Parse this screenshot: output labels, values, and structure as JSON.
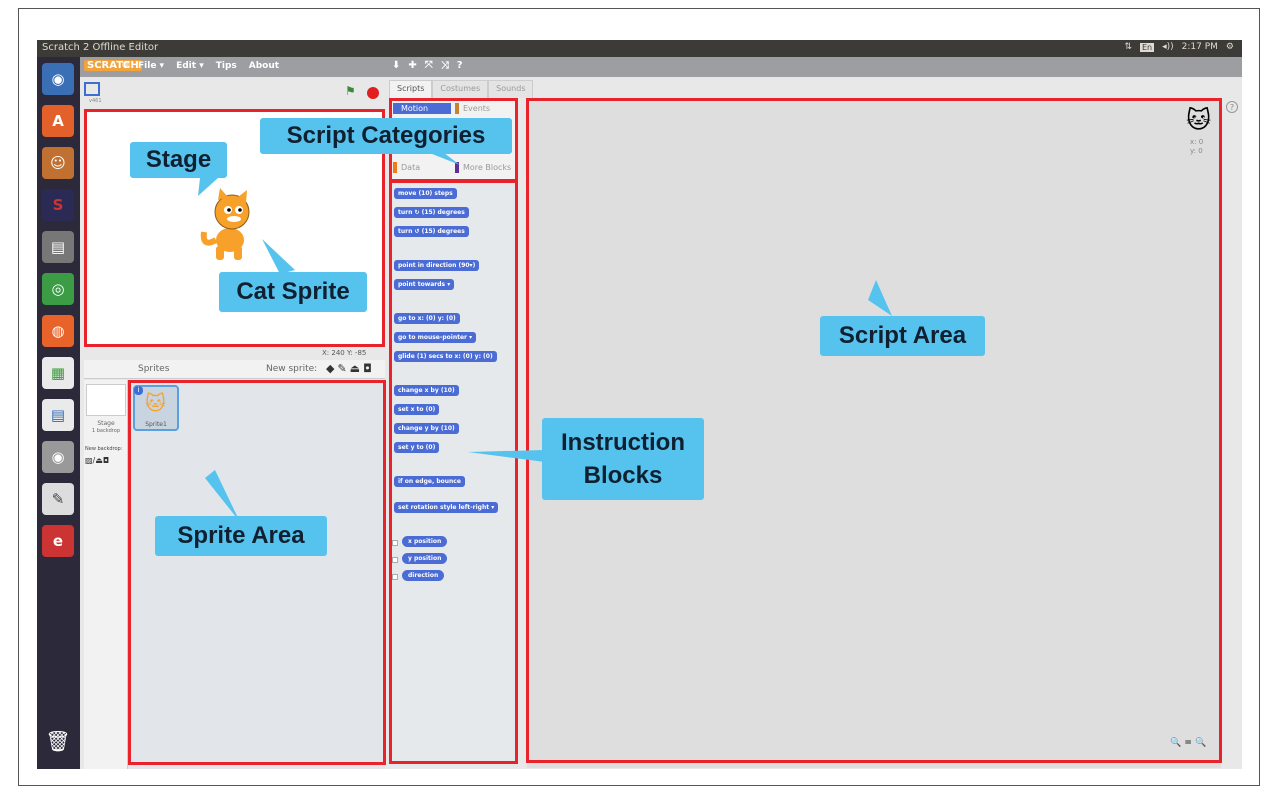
{
  "window": {
    "title": "Scratch 2 Offline Editor"
  },
  "tray": {
    "kbd": "En",
    "volume": "◂))",
    "time": "2:17 PM"
  },
  "menu": {
    "logo": "SCRATCH",
    "items": [
      "File ▾",
      "Edit ▾",
      "Tips",
      "About"
    ]
  },
  "stage": {
    "version": "v461",
    "coords_x": "X: 240",
    "coords_y": "Y: -85"
  },
  "tabs": [
    "Scripts",
    "Costumes",
    "Sounds"
  ],
  "categories": {
    "motion": "Motion",
    "events": "Events",
    "data": "Data",
    "more": "More Blocks"
  },
  "blocks": [
    "move (10) steps",
    "turn ↻ (15) degrees",
    "turn ↺ (15) degrees",
    "point in direction (90▾)",
    "point towards ▾",
    "go to x: (0) y: (0)",
    "go to mouse-pointer ▾",
    "glide (1) secs to x: (0) y: (0)",
    "change x by (10)",
    "set x to (0)",
    "change y by (10)",
    "set y to (0)",
    "if on edge, bounce",
    "set rotation style left-right ▾"
  ],
  "reporters": [
    "x position",
    "y position",
    "direction"
  ],
  "sprites_panel": {
    "header": "Sprites",
    "new_sprite": "New sprite:",
    "stage_label": "Stage",
    "stage_sub": "1 backdrop",
    "new_backdrop": "New backdrop:",
    "sprite_name": "Sprite1",
    "sprite_index": "i"
  },
  "script_xy": {
    "x": "x: 0",
    "y": "y: 0"
  },
  "zoom": "🔍 = 🔍",
  "annotations": {
    "script_categories": "Script Categories",
    "stage": "Stage",
    "cat_sprite": "Cat Sprite",
    "script_area": "Script Area",
    "instruction_blocks": "Instruction Blocks",
    "sprite_area": "Sprite Area"
  },
  "colors": {
    "annotation_box": "#e8232b",
    "callout": "#56c3ef",
    "motion_block": "#4a6cd4",
    "launcher": "#2c2a3a"
  }
}
